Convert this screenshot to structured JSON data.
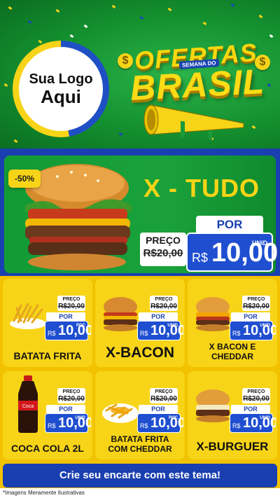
{
  "header": {
    "logo_line1": "Sua Logo",
    "logo_line2": "Aqui",
    "title_top": "OFERTAS",
    "title_sub": "SEMANA DO",
    "title_main": "BRASIL",
    "dollar_symbol": "$"
  },
  "featured": {
    "discount_badge": "-50%",
    "name": "X - TUDO",
    "preco_label": "PREÇO",
    "old_price": "R$20,00",
    "por_label": "POR",
    "currency": "R$",
    "new_price": "10,00",
    "unit": "UNID"
  },
  "products": [
    {
      "name": "BATATA FRITA",
      "preco_label": "PREÇO",
      "old_price": "R$20,00",
      "por_label": "POR",
      "currency": "R$",
      "new_price": "10,00",
      "unit": "POÇ"
    },
    {
      "name": "X-BACON",
      "preco_label": "PREÇO",
      "old_price": "R$20,00",
      "por_label": "POR",
      "currency": "R$",
      "new_price": "10,00",
      "unit": "UNID"
    },
    {
      "name": "X BACON E CHEDDAR",
      "preco_label": "PREÇO",
      "old_price": "R$20,00",
      "por_label": "POR",
      "currency": "R$",
      "new_price": "10,00",
      "unit": "UNID"
    },
    {
      "name": "COCA COLA 2L",
      "preco_label": "PREÇO",
      "old_price": "R$20,00",
      "por_label": "POR",
      "currency": "R$",
      "new_price": "10,00",
      "unit": "UNID"
    },
    {
      "name": "BATATA FRITA COM CHEDDAR",
      "preco_label": "PREÇO",
      "old_price": "R$20,00",
      "por_label": "POR",
      "currency": "R$",
      "new_price": "10,00",
      "unit": "POÇ"
    },
    {
      "name": "X-BURGUER",
      "preco_label": "PREÇO",
      "old_price": "R$20,00",
      "por_label": "POR",
      "currency": "R$",
      "new_price": "10,00",
      "unit": "UNID"
    }
  ],
  "footer": {
    "cta": "Crie seu encarte com este tema!",
    "disclaimer": "*Imagens Meramente Ilustrativas"
  },
  "colors": {
    "green": "#14902f",
    "yellow": "#f7d417",
    "blue": "#1a3fb0"
  }
}
